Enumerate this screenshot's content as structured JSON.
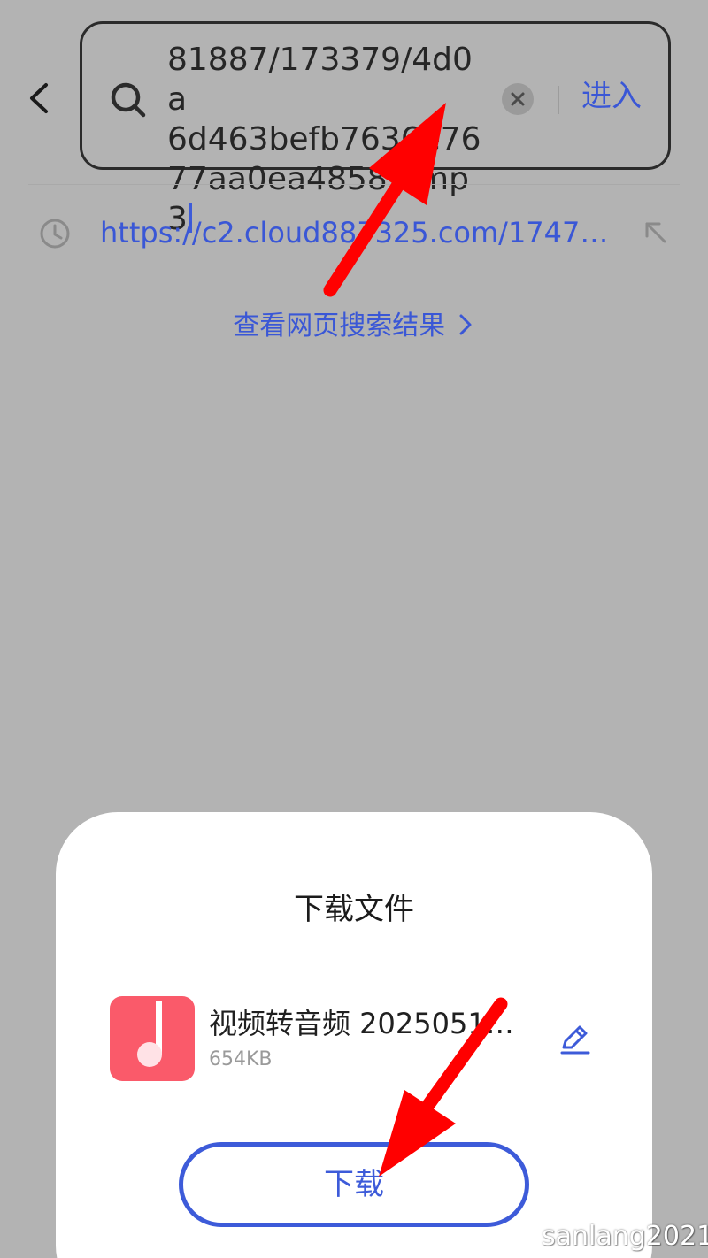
{
  "address_bar": {
    "url_lines": [
      "81887/173379/4d0a",
      "6d463befb7636e76",
      "77aa0ea48585.mp3"
    ],
    "enter_label": "进入"
  },
  "suggestions": {
    "history_url": "https://c2.cloud887325.com/17470…",
    "web_results_label": "查看网页搜索结果"
  },
  "download_dialog": {
    "title": "下载文件",
    "file_name": "视频转音频 20250512…",
    "file_size": "654KB",
    "download_label": "下载"
  },
  "watermark": "sanlang2021",
  "colors": {
    "background": "#b3b3b3",
    "accent": "#3a57d6",
    "file_icon": "#fa5a6a",
    "annotation_arrow": "#ff0000"
  },
  "icons": {
    "back": "chevron-left-icon",
    "search": "search-icon",
    "clear": "close-icon",
    "history": "clock-icon",
    "fill": "arrow-up-left-icon",
    "file": "music-note-icon",
    "edit": "pencil-icon"
  }
}
